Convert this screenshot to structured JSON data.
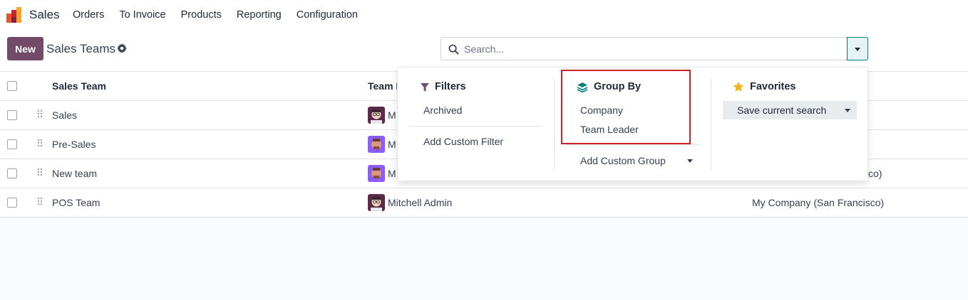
{
  "navbar": {
    "app_name": "Sales",
    "items": [
      "Orders",
      "To Invoice",
      "Products",
      "Reporting",
      "Configuration"
    ]
  },
  "control_panel": {
    "new_label": "New",
    "title": "Sales Teams",
    "search_placeholder": "Search..."
  },
  "table": {
    "headers": {
      "team": "Sales Team",
      "leader": "Team L",
      "company": ""
    },
    "rows": [
      {
        "name": "Sales",
        "leader": "M",
        "company": ""
      },
      {
        "name": "Pre-Sales",
        "leader": "M",
        "company": ""
      },
      {
        "name": "New team",
        "leader": "M",
        "company": "co)"
      },
      {
        "name": "POS Team",
        "leader": "Mitchell Admin",
        "company": "My Company (San Francisco)"
      }
    ]
  },
  "dropdown": {
    "filters": {
      "title": "Filters",
      "items": [
        "Archived"
      ],
      "add_custom": "Add Custom Filter"
    },
    "group_by": {
      "title": "Group By",
      "items": [
        "Company",
        "Team Leader"
      ],
      "add_custom": "Add Custom Group"
    },
    "favorites": {
      "title": "Favorites",
      "save_search": "Save current search"
    }
  },
  "colors": {
    "brand": "#714b67",
    "accent": "#017e84",
    "highlight": "#d11f2a"
  }
}
